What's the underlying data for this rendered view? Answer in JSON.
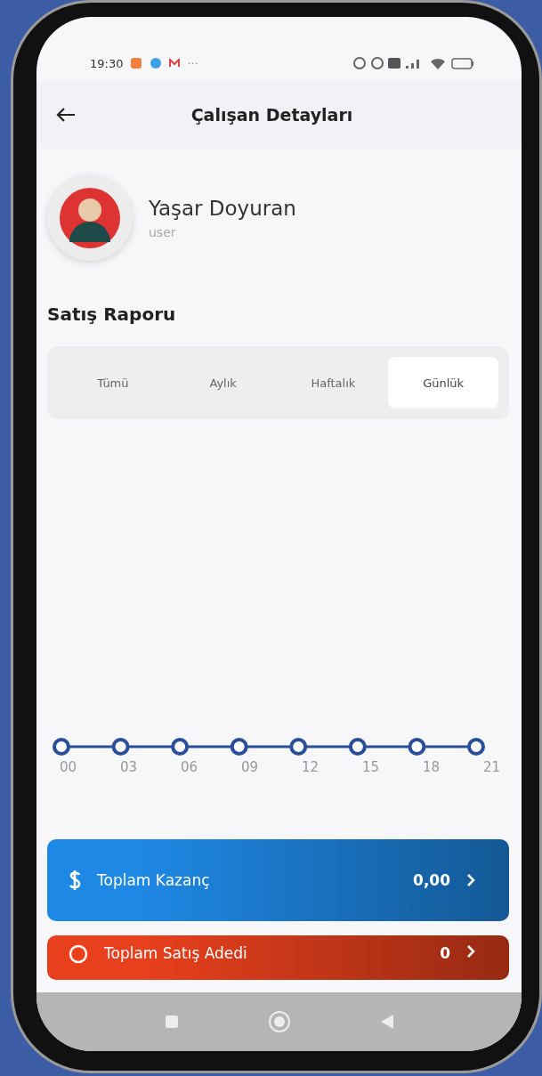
{
  "status_bar": {
    "time": "19:30",
    "more": "···"
  },
  "app_bar": {
    "title": "Çalışan Detayları"
  },
  "profile": {
    "name": "Yaşar Doyuran",
    "role": "user"
  },
  "section_title": "Satış Raporu",
  "tabs": [
    {
      "label": "Tümü",
      "selected": false
    },
    {
      "label": "Aylık",
      "selected": false
    },
    {
      "label": "Haftalık",
      "selected": false
    },
    {
      "label": "Günlük",
      "selected": true
    }
  ],
  "chart": {
    "x_labels": [
      "00",
      "03",
      "06",
      "09",
      "12",
      "15",
      "18",
      "21"
    ]
  },
  "summary_cards": [
    {
      "kind": "earnings",
      "label": "Toplam Kazanç",
      "value": "0,00",
      "color": "#1e88e5"
    },
    {
      "kind": "sales",
      "label": "Toplam Satış Adedi",
      "value": "0",
      "color": "#e8401c"
    }
  ]
}
